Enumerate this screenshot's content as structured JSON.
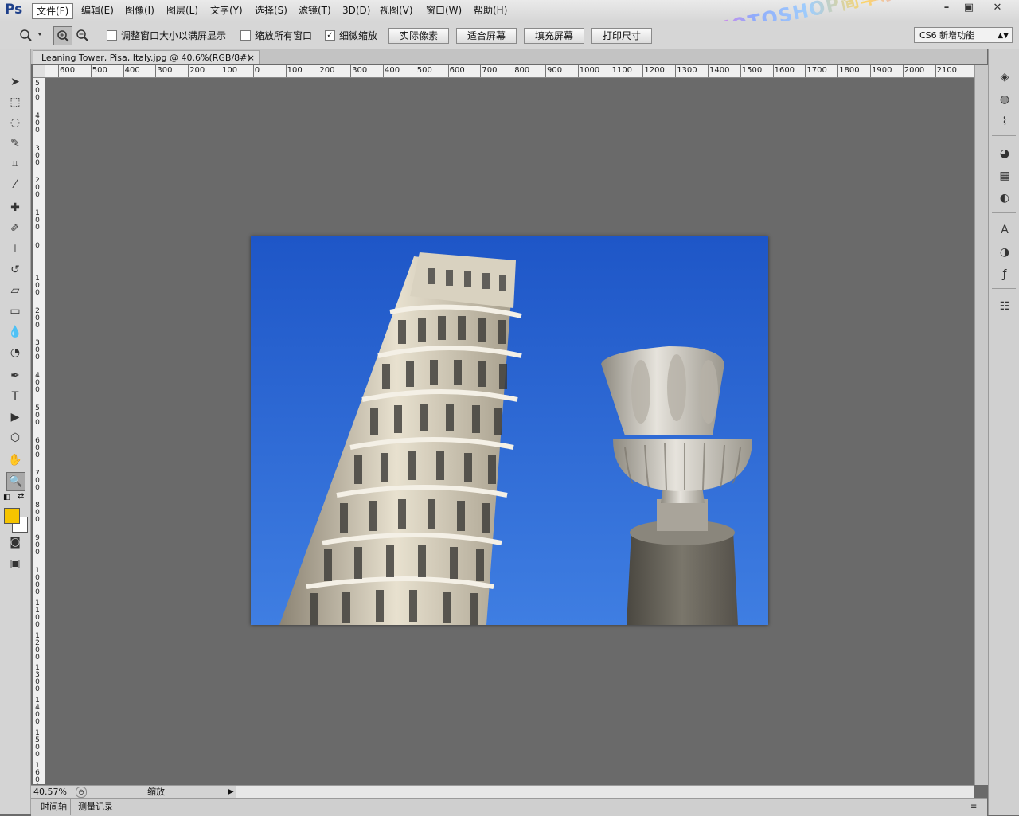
{
  "app": {
    "logo": "Ps"
  },
  "menu": [
    "文件(F)",
    "编辑(E)",
    "图像(I)",
    "图层(L)",
    "文字(Y)",
    "选择(S)",
    "滤镜(T)",
    "3D(D)",
    "视图(V)",
    "窗口(W)",
    "帮助(H)"
  ],
  "window_controls": {
    "minimize": "–",
    "restore": "▣",
    "close": "✕"
  },
  "options": {
    "resize_windows_label": "调整窗口大小以满屏显示",
    "resize_windows_checked": false,
    "zoom_all_label": "缩放所有窗口",
    "zoom_all_checked": false,
    "scrubby_label": "细微缩放",
    "scrubby_checked": true,
    "actual_pixels": "实际像素",
    "fit_screen": "适合屏幕",
    "fill_screen": "填充屏幕",
    "print_size": "打印尺寸",
    "workspace": "CS6 新增功能"
  },
  "document": {
    "tab_title": "Leaning Tower, Pisa, Italy.jpg @ 40.6%(RGB/8#)",
    "close": "×"
  },
  "ruler_h": [
    "600",
    "500",
    "400",
    "300",
    "200",
    "100",
    "0",
    "100",
    "200",
    "300",
    "400",
    "500",
    "600",
    "700",
    "800",
    "900",
    "1000",
    "1100",
    "1200",
    "1300",
    "1400",
    "1500",
    "1600",
    "1700",
    "1800",
    "1900",
    "2000",
    "2100"
  ],
  "ruler_v": [
    "5\n0\n0",
    "4\n0\n0",
    "3\n0\n0",
    "2\n0\n0",
    "1\n0\n0",
    "0",
    "1\n0\n0",
    "2\n0\n0",
    "3\n0\n0",
    "4\n0\n0",
    "5\n0\n0",
    "6\n0\n0",
    "7\n0\n0",
    "8\n0\n0",
    "9\n0\n0",
    "1\n0\n0\n0",
    "1\n1\n0\n0",
    "1\n2\n0\n0",
    "1\n3\n0\n0",
    "1\n4\n0\n0",
    "1\n5\n0\n0",
    "1\n6\n0\n0"
  ],
  "status": {
    "zoom": "40.57%",
    "tool_name": "缩放"
  },
  "bottom_tabs": [
    "时间轴",
    "测量记录"
  ],
  "colors": {
    "foreground": "#f5c400",
    "background": "#ffffff",
    "sky": "#2a63d8"
  },
  "watermark": "PHOTOSHOP简单系列"
}
